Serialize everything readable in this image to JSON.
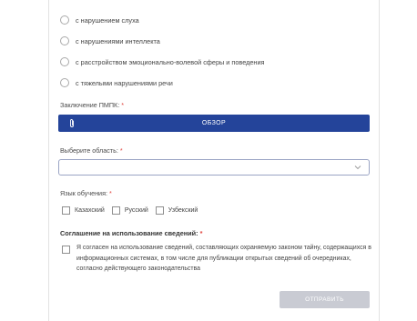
{
  "disability_options": [
    {
      "label": "с нарушением слуха"
    },
    {
      "label": "с нарушениями интеллекта"
    },
    {
      "label": "с расстройством эмоционально-волевой сферы и поведения"
    },
    {
      "label": "с тяжелыми нарушениями речи"
    }
  ],
  "pmpk": {
    "label": "Заключение ПМПК:",
    "required_mark": "*",
    "browse_label": "ОБЗОР"
  },
  "region": {
    "label": "Выберите область:",
    "required_mark": "*",
    "value": ""
  },
  "language": {
    "label": "Язык обучения:",
    "required_mark": "*",
    "options": [
      {
        "label": "Казахский",
        "checked": false
      },
      {
        "label": "Русский",
        "checked": false
      },
      {
        "label": "Узбекский",
        "checked": false
      }
    ]
  },
  "consent": {
    "title": "Соглашение на использование сведений:",
    "required_mark": "*",
    "text": "Я согласен на использование сведений, составляющих охраняемую законом тайну, содержащихся в информационных системах, в том числе для публикации открытых сведений об очередниках, согласно действующего законодательства",
    "checked": false
  },
  "submit_label": "ОТПРАВИТЬ",
  "colors": {
    "primary": "#24449a",
    "required": "#e0443e",
    "disabled_button": "#c9cbd3"
  }
}
